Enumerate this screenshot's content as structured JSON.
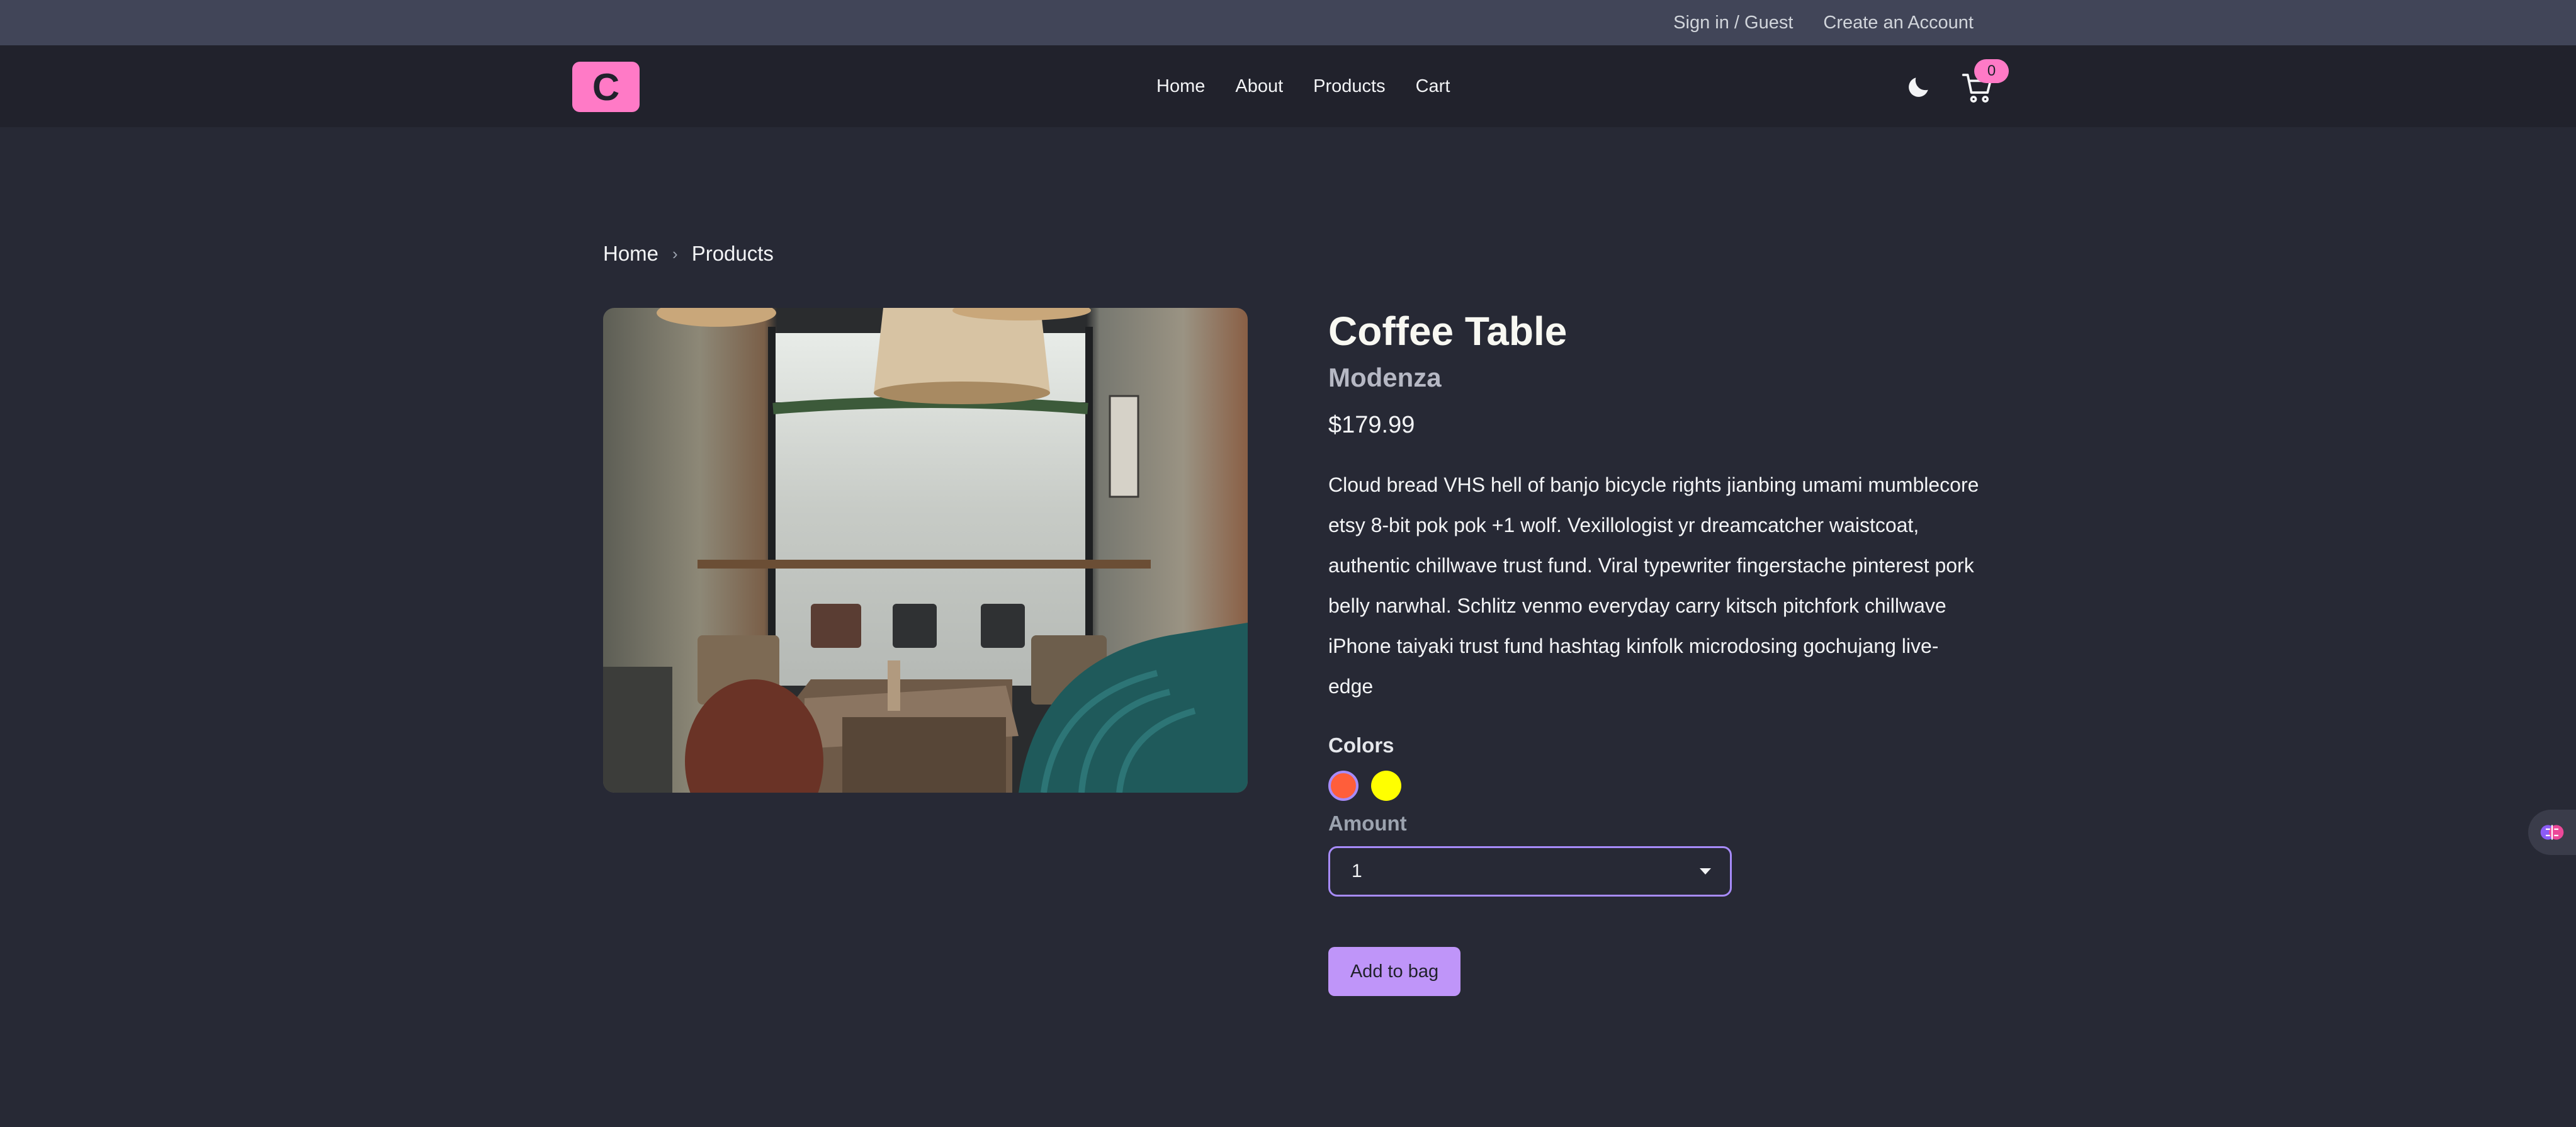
{
  "topbar": {
    "sign_in": "Sign in / Guest",
    "create_account": "Create an Account"
  },
  "navbar": {
    "logo": "C",
    "links": [
      "Home",
      "About",
      "Products",
      "Cart"
    ],
    "cart_count": "0",
    "theme_icon": "moon-icon",
    "cart_icon": "cart-icon"
  },
  "breadcrumb": {
    "home": "Home",
    "products": "Products"
  },
  "product": {
    "title": "Coffee Table",
    "company": "Modenza",
    "price": "$179.99",
    "description": "Cloud bread VHS hell of banjo bicycle rights jianbing umami mumblecore etsy 8-bit pok pok +1 wolf. Vexillologist yr dreamcatcher waistcoat, authentic chillwave trust fund. Viral typewriter fingerstache pinterest pork belly narwhal. Schlitz venmo everyday carry kitsch pitchfork chillwave iPhone taiyaki trust fund hashtag kinfolk microdosing gochujang live-edge",
    "colors_label": "Colors",
    "colors": [
      "#ff5e3a",
      "#ffff00"
    ],
    "amount_label": "Amount",
    "amount_value": "1",
    "add_button": "Add to bag"
  },
  "colors": {
    "background": "#272935",
    "topbar": "#414558",
    "navbar": "#21222c",
    "primary": "#ff7ac6",
    "secondary": "#bf95f9"
  }
}
